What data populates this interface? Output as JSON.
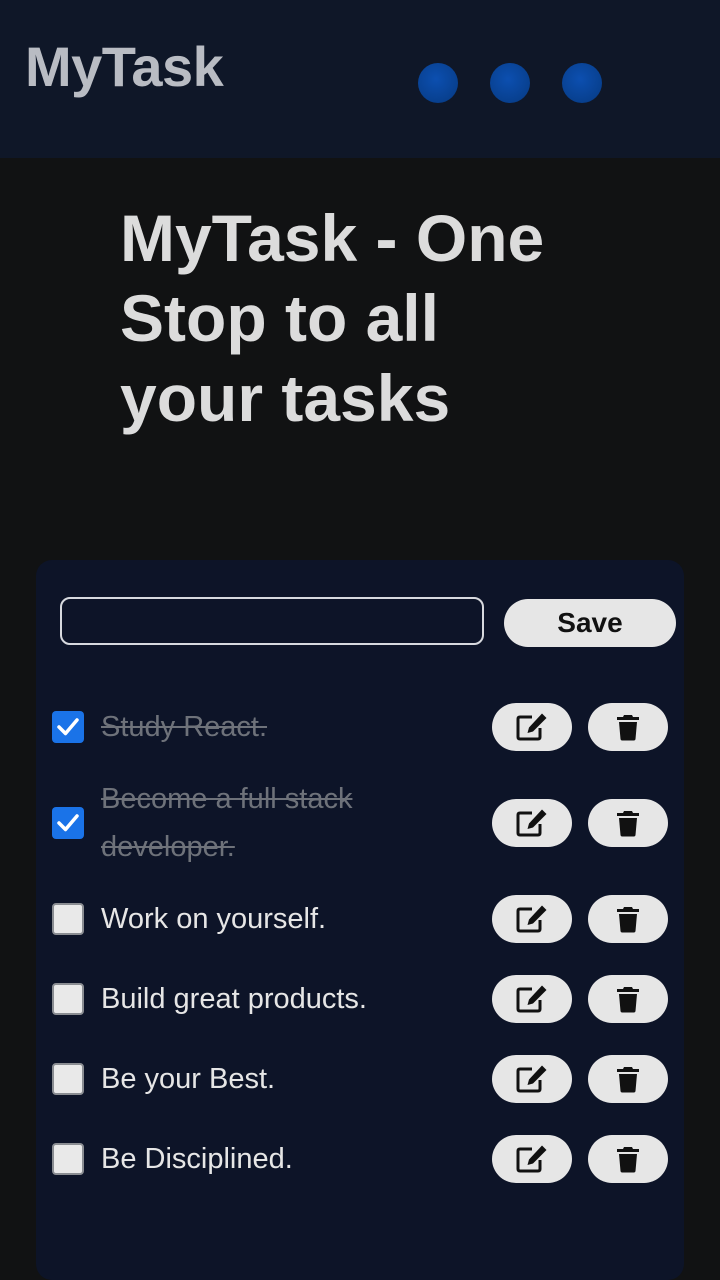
{
  "header": {
    "brand": "MyTask",
    "dots": [
      {
        "color": "#0a47a0"
      },
      {
        "color": "#0a47a0"
      },
      {
        "color": "#0a47a0"
      }
    ]
  },
  "hero": {
    "line1": "MyTask - One",
    "line2": "Stop to all",
    "line3": "your tasks"
  },
  "form": {
    "input_value": "",
    "input_placeholder": "",
    "save_label": "Save"
  },
  "tasks": [
    {
      "text": "Study React.",
      "done": true
    },
    {
      "text": "Become a full stack",
      "text_line2": "developer.",
      "done": true
    },
    {
      "text": "Work on yourself.",
      "done": false
    },
    {
      "text": "Build great products.",
      "done": false
    },
    {
      "text": "Be your Best.",
      "done": false
    },
    {
      "text": "Be Disciplined.",
      "done": false
    }
  ],
  "icons": {
    "edit": "edit-icon",
    "delete": "trash-icon",
    "check": "check-icon"
  },
  "colors": {
    "header_bg": "#0f1728",
    "page_bg": "#111213",
    "panel_bg": "#0d1428",
    "accent_checkbox": "#1a73e8"
  }
}
